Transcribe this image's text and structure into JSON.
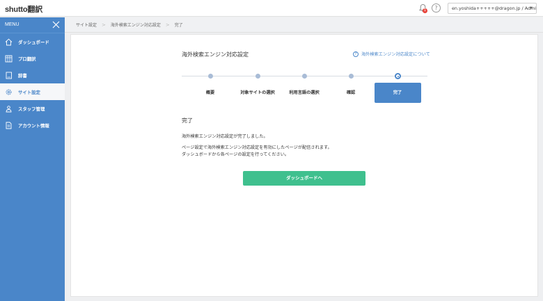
{
  "header": {
    "logo_brand": "shutto",
    "logo_suffix": "翻訳",
    "notification_count": "1",
    "help_glyph": "?",
    "account": "en.yoshida+++++@dragon.jp / Admin",
    "account_caret": "▼"
  },
  "sidebar": {
    "menu_label": "MENU",
    "items": [
      {
        "label": "ダッシュボード",
        "icon": "home-icon"
      },
      {
        "label": "プロ翻訳",
        "icon": "grid-icon"
      },
      {
        "label": "辞書",
        "icon": "book-icon"
      },
      {
        "label": "サイト設定",
        "icon": "gear-icon",
        "active": true
      },
      {
        "label": "スタッフ管理",
        "icon": "staff-icon"
      },
      {
        "label": "アカウント情報",
        "icon": "document-icon"
      }
    ]
  },
  "breadcrumb": [
    "サイト設定",
    "海外検索エンジン対応設定",
    "完了"
  ],
  "breadcrumb_sep": ">",
  "main": {
    "title": "海外検索エンジン対応設定",
    "about_link": "海外検索エンジン対応設定について",
    "about_glyph": "?",
    "steps": [
      "概要",
      "対象サイトの選択",
      "利用言語の選択",
      "確認",
      "完了"
    ],
    "current_step": 5,
    "section_title": "完了",
    "message1": "海外検索エンジン対応設定が完了しました。",
    "message2": "ページ設定で海外検索エンジン対応設定を有効にしたページが配信されます。",
    "message3": "ダッシュボードから各ページの設定を行ってください。",
    "dashboard_button": "ダッシュボードへ"
  },
  "colors": {
    "sidebar": "#4a86c9",
    "primary_button": "#3fc08e",
    "badge": "#e8453c"
  }
}
